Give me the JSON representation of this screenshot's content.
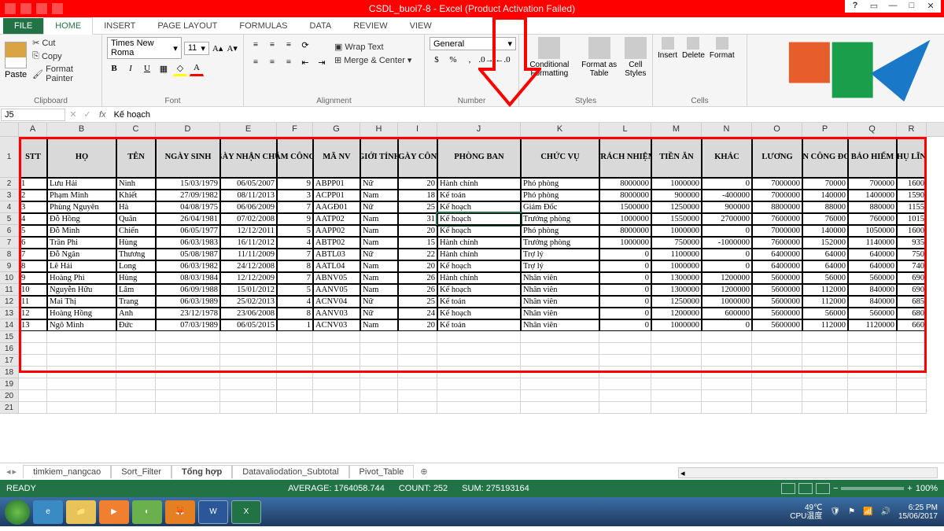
{
  "title": {
    "doc": "CSDL_buoi7-8",
    "app": " -  Excel",
    "warn": "(Product Activation Failed)"
  },
  "wctl": {
    "help": "?",
    "opts": "▭",
    "min": "—",
    "max": "□",
    "close": "✕"
  },
  "tabs": {
    "file": "FILE",
    "list": [
      "HOME",
      "INSERT",
      "PAGE LAYOUT",
      "FORMULAS",
      "DATA",
      "REVIEW",
      "VIEW"
    ],
    "active": 0
  },
  "ribbon": {
    "clipboard": {
      "label": "Clipboard",
      "paste": "Paste",
      "cut": "Cut",
      "copy": "Copy",
      "fp": "Format Painter"
    },
    "font": {
      "label": "Font",
      "name": "Times New Roma",
      "size": "11",
      "b": "B",
      "i": "I",
      "u": "U"
    },
    "align": {
      "label": "Alignment",
      "wrap": "Wrap Text",
      "merge": "Merge & Center"
    },
    "number": {
      "label": "Number",
      "fmt": "General"
    },
    "styles": {
      "label": "Styles",
      "cf": "Conditional Formatting",
      "fat": "Format as Table",
      "cs": "Cell Styles"
    },
    "cells": {
      "label": "Cells",
      "ins": "Insert",
      "del": "Delete",
      "fmt": "Format"
    }
  },
  "fbar": {
    "name": "J5",
    "fx": "fx",
    "val": "Kế hoạch"
  },
  "cols": [
    "A",
    "B",
    "C",
    "D",
    "E",
    "F",
    "G",
    "H",
    "I",
    "J",
    "K",
    "L",
    "M",
    "N",
    "O",
    "P",
    "Q",
    "R"
  ],
  "headers": [
    "STT",
    "HỌ",
    "TÊN",
    "NGÀY SINH",
    "NGÀY NHẬN CHỨC",
    "SỐ NĂM CÔNG TÁC",
    "MÃ NV",
    "GIỚI TÍNH",
    "NGÀY CÔNG",
    "PHÒNG BAN",
    "CHỨC VỤ",
    "TRÁCH NHIỆM",
    "TIỀN ĂN",
    "KHÁC",
    "LƯƠNG",
    "TIỀN CÔNG ĐOÀN",
    "BẢO HIỂM",
    "THỤ LĨNH"
  ],
  "rows": [
    [
      "1",
      "Lưu Hải",
      "Ninh",
      "15/03/1979",
      "06/05/2007",
      "9",
      "ABPP01",
      "Nữ",
      "20",
      "Hành chính",
      "Phó phòng",
      "8000000",
      "1000000",
      "0",
      "7000000",
      "70000",
      "700000",
      "1600"
    ],
    [
      "2",
      "Phạm Minh",
      "Khiết",
      "27/09/1982",
      "08/11/2013",
      "3",
      "ACPP01",
      "Nam",
      "18",
      "Kế toán",
      "Phó phòng",
      "8000000",
      "900000",
      "-400000",
      "7000000",
      "140000",
      "1400000",
      "1590"
    ],
    [
      "3",
      "Phùng Nguyên",
      "Hà",
      "04/08/1975",
      "06/06/2009",
      "7",
      "AAGĐ01",
      "Nữ",
      "25",
      "Kế hoạch",
      "Giám Đốc",
      "1500000",
      "1250000",
      "900000",
      "8800000",
      "88000",
      "880000",
      "1155"
    ],
    [
      "4",
      "Đỗ Hồng",
      "Quân",
      "26/04/1981",
      "07/02/2008",
      "9",
      "AATP02",
      "Nam",
      "31",
      "Kế hoạch",
      "Trưởng phòng",
      "1000000",
      "1550000",
      "2700000",
      "7600000",
      "76000",
      "760000",
      "1015"
    ],
    [
      "5",
      "Đỗ Minh",
      "Chiến",
      "06/05/1977",
      "12/12/2011",
      "5",
      "AAPP02",
      "Nam",
      "20",
      "Kế hoạch",
      "Phó phòng",
      "8000000",
      "1000000",
      "0",
      "7000000",
      "140000",
      "1050000",
      "1600"
    ],
    [
      "6",
      "Trần Phi",
      "Hùng",
      "06/03/1983",
      "16/11/2012",
      "4",
      "ABTP02",
      "Nam",
      "15",
      "Hành chính",
      "Trưởng phòng",
      "1000000",
      "750000",
      "-1000000",
      "7600000",
      "152000",
      "1140000",
      "935"
    ],
    [
      "7",
      "Đỗ Ngân",
      "Thương",
      "05/08/1987",
      "11/11/2009",
      "7",
      "ABTL03",
      "Nữ",
      "22",
      "Hành chính",
      "Trợ lý",
      "0",
      "1100000",
      "0",
      "6400000",
      "64000",
      "640000",
      "750"
    ],
    [
      "8",
      "Lê Hải",
      "Long",
      "06/03/1982",
      "24/12/2008",
      "8",
      "AATL04",
      "Nam",
      "20",
      "Kế hoạch",
      "Trợ lý",
      "0",
      "1000000",
      "0",
      "6400000",
      "64000",
      "640000",
      "740"
    ],
    [
      "9",
      "Hoàng Phi",
      "Hùng",
      "08/03/1984",
      "12/12/2009",
      "7",
      "ABNV05",
      "Nam",
      "26",
      "Hành chính",
      "Nhân viên",
      "0",
      "1300000",
      "1200000",
      "5600000",
      "56000",
      "560000",
      "690"
    ],
    [
      "10",
      "Nguyễn Hữu",
      "Lâm",
      "06/09/1988",
      "15/01/2012",
      "5",
      "AANV05",
      "Nam",
      "26",
      "Kế hoạch",
      "Nhân viên",
      "0",
      "1300000",
      "1200000",
      "5600000",
      "112000",
      "840000",
      "690"
    ],
    [
      "11",
      "Mai Thị",
      "Trang",
      "06/03/1989",
      "25/02/2013",
      "4",
      "ACNV04",
      "Nữ",
      "25",
      "Kế toán",
      "Nhân viên",
      "0",
      "1250000",
      "1000000",
      "5600000",
      "112000",
      "840000",
      "685"
    ],
    [
      "12",
      "Hoàng Hồng",
      "Anh",
      "23/12/1978",
      "23/06/2008",
      "8",
      "AANV03",
      "Nữ",
      "24",
      "Kế hoạch",
      "Nhân viên",
      "0",
      "1200000",
      "600000",
      "5600000",
      "56000",
      "560000",
      "680"
    ],
    [
      "13",
      "Ngô Minh",
      "Đức",
      "07/03/1989",
      "06/05/2015",
      "1",
      "ACNV03",
      "Nam",
      "20",
      "Kế toán",
      "Nhân viên",
      "0",
      "1000000",
      "0",
      "5600000",
      "112000",
      "1120000",
      "660"
    ]
  ],
  "sheets": {
    "list": [
      "timkiem_nangcao",
      "Sort_Filter",
      "Tổng hợp",
      "Datavaliodation_Subtotal",
      "Pivot_Table"
    ],
    "active": 2
  },
  "status": {
    "ready": "READY",
    "avg": "AVERAGE: 1764058.744",
    "cnt": "COUNT: 252",
    "sum": "SUM: 275193164",
    "zoom": "100%"
  },
  "taskbar": {
    "temp": "49℃",
    "cpu": "CPU温度",
    "time": "6:25 PM",
    "date": "15/06/2017"
  }
}
